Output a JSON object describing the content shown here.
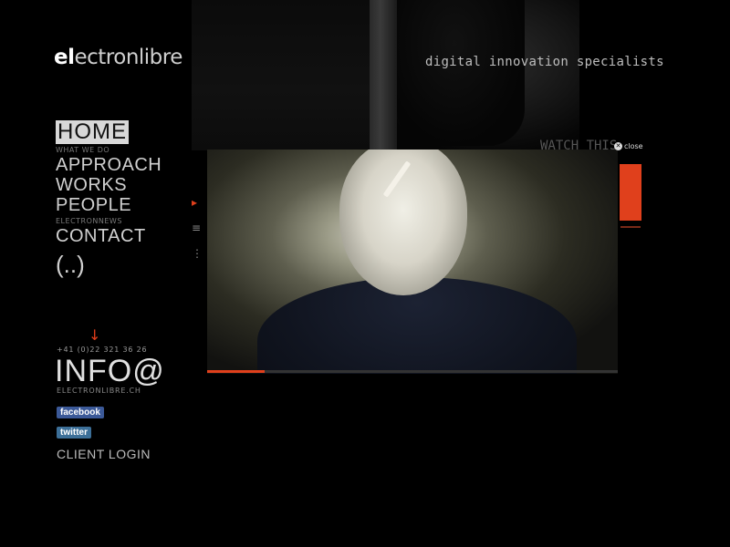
{
  "header": {
    "logo_bold": "el",
    "logo_rest": "ectronlibre",
    "tagline": "digital innovation specialists"
  },
  "nav": {
    "home": "HOME",
    "what_we_do": "WHAT WE DO",
    "approach": "APPROACH",
    "works": "WORKS",
    "people": "PEOPLE",
    "electronnews": "ELECTRONNEWS",
    "contact": "CONTACT",
    "more": "(..)"
  },
  "contact": {
    "phone": "+41 (0)22 321 36 26",
    "info": "INFO@",
    "email": "ELECTRONLIBRE.CH",
    "facebook": "facebook",
    "twitter": "twitter",
    "client_login": "CLIENT LOGIN"
  },
  "video": {
    "close_label": "close",
    "watch_label": "WATCH THIS",
    "progress": 0.14
  },
  "accent_color": "#e0401c"
}
